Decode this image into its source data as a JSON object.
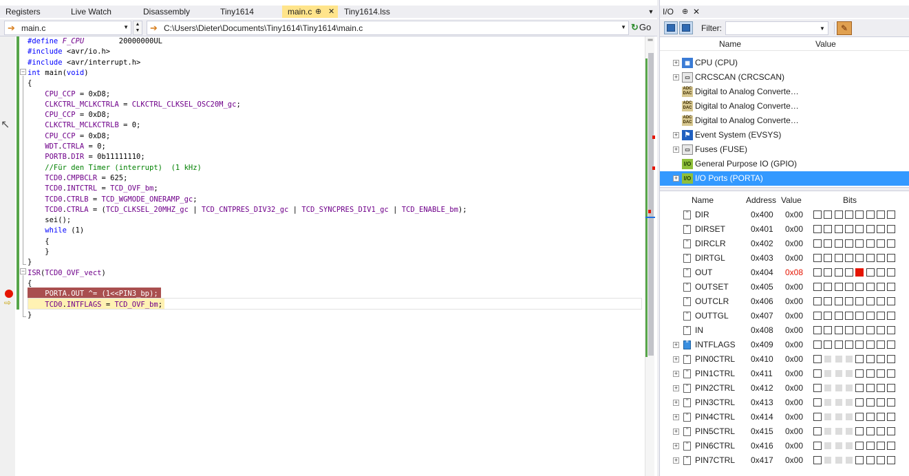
{
  "editor": {
    "tabs": [
      {
        "label": "Registers",
        "active": false
      },
      {
        "label": "Live Watch",
        "active": false
      },
      {
        "label": "Disassembly",
        "active": false
      },
      {
        "label": "Tiny1614",
        "active": false
      },
      {
        "label": "main.c",
        "active": true
      },
      {
        "label": "Tiny1614.lss",
        "active": false
      }
    ],
    "pin_glyph": "⊕",
    "close_glyph": "✕",
    "overflow_glyph": "▼",
    "file_combo": "main.c",
    "path_combo": "C:\\Users\\Dieter\\Documents\\Tiny1614\\Tiny1614\\main.c",
    "go_label": "Go",
    "go_icon": "refresh-green-icon",
    "code": [
      "#define F_CPU        20000000UL",
      "#include <avr/io.h>",
      "#include <avr/interrupt.h>",
      "int main(void)",
      "{",
      "    CPU_CCP = 0xD8;",
      "    CLKCTRL_MCLKCTRLA = CLKCTRL_CLKSEL_OSC20M_gc;",
      "    CPU_CCP = 0xD8;",
      "    CLKCTRL_MCLKCTRLB = 0;",
      "    CPU_CCP = 0xD8;",
      "    WDT.CTRLA = 0;",
      "    PORTB.DIR = 0b11111110;",
      "    //Für den Timer (interrupt)  (1 kHz)",
      "    TCD0.CMPBCLR = 625;",
      "    TCD0.INTCTRL = TCD_OVF_bm;",
      "    TCD0.CTRLB = TCD_WGMODE_ONERAMP_gc;",
      "    TCD0.CTRLA = (TCD_CLKSEL_20MHZ_gc | TCD_CNTPRES_DIV32_gc | TCD_SYNCPRES_DIV1_gc | TCD_ENABLE_bm);",
      "    sei();",
      "    while (1)",
      "    {",
      "    }",
      "}",
      "ISR(TCD0_OVF_vect)",
      "{",
      "    PORTA.OUT ^= (1<<PIN3_bp);",
      "    TCD0.INTFLAGS = TCD_OVF_bm;",
      "}"
    ],
    "colors": {
      "keyword": "#0000ff",
      "macro": "#6f008a",
      "comment": "#008000",
      "breakpoint": "#e51400",
      "exec_line": "#fff2b3"
    }
  },
  "io": {
    "title": "I/O",
    "pin_glyph": "⊕",
    "close_glyph": "✕",
    "filter_label": "Filter:",
    "filter_value": "",
    "module_columns": {
      "name": "Name",
      "value": "Value"
    },
    "modules": [
      {
        "label": "CPU (CPU)",
        "icon": "cpu-chip-icon",
        "icon_text": "▦",
        "kind": "cpu",
        "expandable": true,
        "selected": false
      },
      {
        "label": "CRCSCAN (CRCSCAN)",
        "icon": "crc-module-icon",
        "icon_text": "▭",
        "kind": "crc",
        "expandable": true,
        "selected": false
      },
      {
        "label": "Digital to Analog Converte…",
        "icon": "adc-dac-icon",
        "icon_text": "ADC DAC",
        "kind": "dac",
        "expandable": false,
        "selected": false
      },
      {
        "label": "Digital to Analog Converte…",
        "icon": "adc-dac-icon",
        "icon_text": "ADC DAC",
        "kind": "dac",
        "expandable": false,
        "selected": false
      },
      {
        "label": "Digital to Analog Converte…",
        "icon": "adc-dac-icon",
        "icon_text": "ADC DAC",
        "kind": "dac",
        "expandable": false,
        "selected": false
      },
      {
        "label": "Event System (EVSYS)",
        "icon": "event-flag-icon",
        "icon_text": "⚑",
        "kind": "ev",
        "expandable": true,
        "selected": false
      },
      {
        "label": "Fuses (FUSE)",
        "icon": "fuse-module-icon",
        "icon_text": "▭",
        "kind": "fuse",
        "expandable": true,
        "selected": false
      },
      {
        "label": "General Purpose IO (GPIO)",
        "icon": "io-module-icon",
        "icon_text": "I/O",
        "kind": "io",
        "expandable": false,
        "selected": false
      },
      {
        "label": "I/O Ports (PORTA)",
        "icon": "io-module-icon",
        "icon_text": "I/O",
        "kind": "io",
        "expandable": true,
        "selected": true
      }
    ],
    "register_columns": {
      "name": "Name",
      "address": "Address",
      "value": "Value",
      "bits": "Bits"
    },
    "registers": [
      {
        "name": "DIR",
        "address": "0x400",
        "value": "0x00",
        "changed": false,
        "expandable": false,
        "icon": "register-doc-icon",
        "bits": "11111111",
        "set": []
      },
      {
        "name": "DIRSET",
        "address": "0x401",
        "value": "0x00",
        "changed": false,
        "expandable": false,
        "icon": "register-doc-icon",
        "bits": "11111111",
        "set": []
      },
      {
        "name": "DIRCLR",
        "address": "0x402",
        "value": "0x00",
        "changed": false,
        "expandable": false,
        "icon": "register-doc-icon",
        "bits": "11111111",
        "set": []
      },
      {
        "name": "DIRTGL",
        "address": "0x403",
        "value": "0x00",
        "changed": false,
        "expandable": false,
        "icon": "register-doc-icon",
        "bits": "11111111",
        "set": []
      },
      {
        "name": "OUT",
        "address": "0x404",
        "value": "0x08",
        "changed": true,
        "expandable": false,
        "icon": "register-doc-icon",
        "bits": "11111111",
        "set": [
          4
        ]
      },
      {
        "name": "OUTSET",
        "address": "0x405",
        "value": "0x00",
        "changed": false,
        "expandable": false,
        "icon": "register-doc-icon",
        "bits": "11111111",
        "set": []
      },
      {
        "name": "OUTCLR",
        "address": "0x406",
        "value": "0x00",
        "changed": false,
        "expandable": false,
        "icon": "register-doc-icon",
        "bits": "11111111",
        "set": []
      },
      {
        "name": "OUTTGL",
        "address": "0x407",
        "value": "0x00",
        "changed": false,
        "expandable": false,
        "icon": "register-doc-icon",
        "bits": "11111111",
        "set": []
      },
      {
        "name": "IN",
        "address": "0x408",
        "value": "0x00",
        "changed": false,
        "expandable": false,
        "icon": "register-doc-icon",
        "bits": "11111111",
        "set": []
      },
      {
        "name": "INTFLAGS",
        "address": "0x409",
        "value": "0x00",
        "changed": false,
        "expandable": true,
        "icon": "interrupt-flag-icon",
        "bits": "11111111",
        "set": []
      },
      {
        "name": "PIN0CTRL",
        "address": "0x410",
        "value": "0x00",
        "changed": false,
        "expandable": true,
        "icon": "register-doc-icon",
        "bits": "10001111",
        "set": []
      },
      {
        "name": "PIN1CTRL",
        "address": "0x411",
        "value": "0x00",
        "changed": false,
        "expandable": true,
        "icon": "register-doc-icon",
        "bits": "10001111",
        "set": []
      },
      {
        "name": "PIN2CTRL",
        "address": "0x412",
        "value": "0x00",
        "changed": false,
        "expandable": true,
        "icon": "register-doc-icon",
        "bits": "10001111",
        "set": []
      },
      {
        "name": "PIN3CTRL",
        "address": "0x413",
        "value": "0x00",
        "changed": false,
        "expandable": true,
        "icon": "register-doc-icon",
        "bits": "10001111",
        "set": []
      },
      {
        "name": "PIN4CTRL",
        "address": "0x414",
        "value": "0x00",
        "changed": false,
        "expandable": true,
        "icon": "register-doc-icon",
        "bits": "10001111",
        "set": []
      },
      {
        "name": "PIN5CTRL",
        "address": "0x415",
        "value": "0x00",
        "changed": false,
        "expandable": true,
        "icon": "register-doc-icon",
        "bits": "10001111",
        "set": []
      },
      {
        "name": "PIN6CTRL",
        "address": "0x416",
        "value": "0x00",
        "changed": false,
        "expandable": true,
        "icon": "register-doc-icon",
        "bits": "10001111",
        "set": []
      },
      {
        "name": "PIN7CTRL",
        "address": "0x417",
        "value": "0x00",
        "changed": false,
        "expandable": true,
        "icon": "register-doc-icon",
        "bits": "10001111",
        "set": []
      }
    ]
  }
}
